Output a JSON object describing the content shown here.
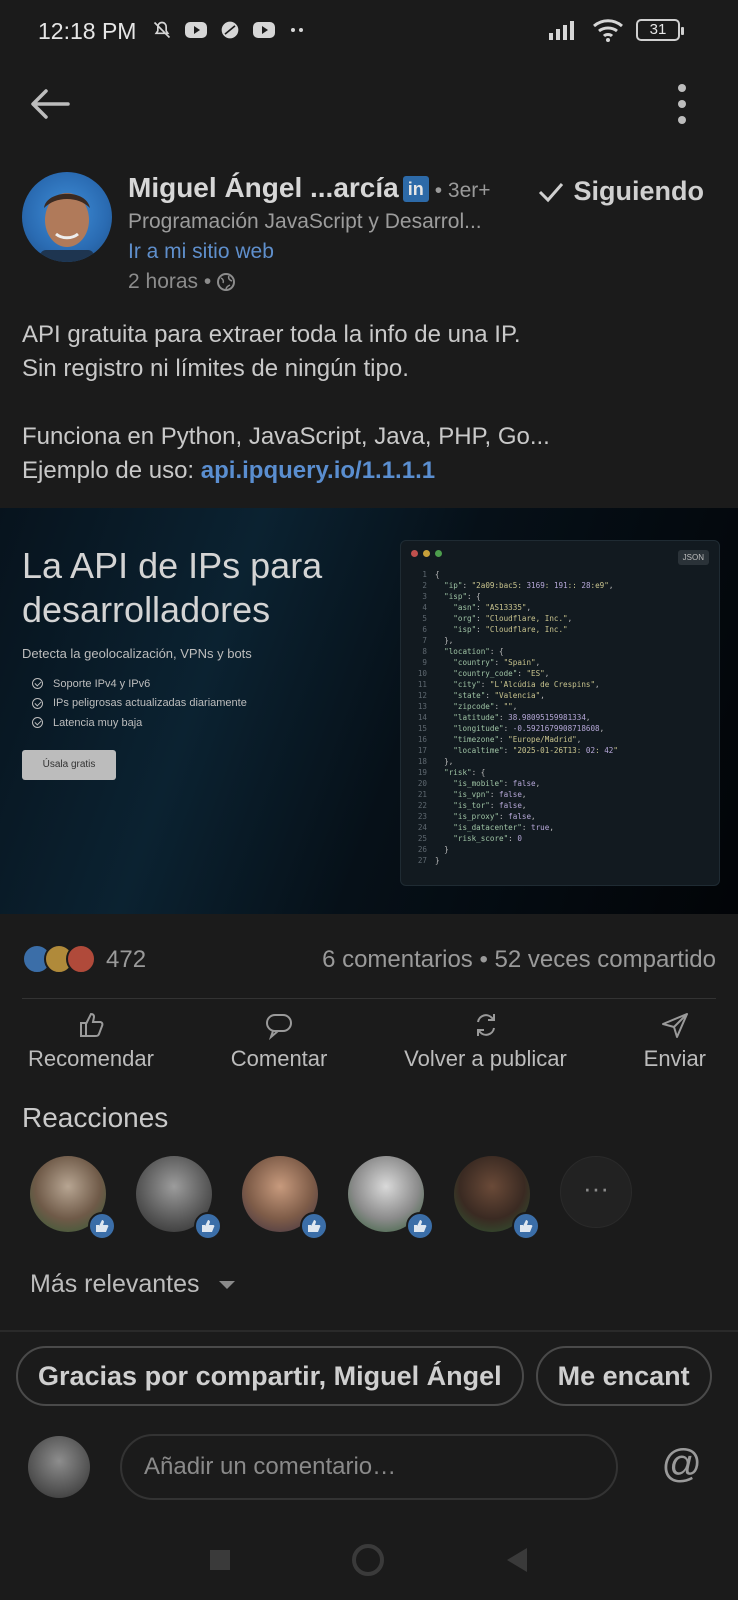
{
  "status_bar": {
    "time": "12:18 PM",
    "battery": "31"
  },
  "author": {
    "name": "Miguel Ángel ...arcía",
    "degree": "• 3er+",
    "headline": "Programación JavaScript y Desarrol...",
    "website": "Ir a mi sitio web",
    "time": "2 horas •",
    "follow_label": "Siguiendo"
  },
  "post": {
    "line1": "API gratuita para extraer toda la info de una IP.",
    "line2": "Sin registro ni límites de ningún tipo.",
    "line3": "Funciona en Python, JavaScript, Java, PHP, Go...",
    "line4_prefix": "Ejemplo de uso: ",
    "line4_link": "api.ipquery.io/1.1.1.1"
  },
  "image": {
    "title": "La API de IPs para desarrolladores",
    "subtitle": "Detecta la geolocalización, VPNs y bots",
    "features": [
      "Soporte IPv4 y IPv6",
      "IPs peligrosas actualizadas diariamente",
      "Latencia muy baja"
    ],
    "button": "Úsala gratis",
    "json_tag": "JSON",
    "code_lines": [
      "{",
      "  \"ip\": \"2a09:bac5:3169:191::28:e9\",",
      "  \"isp\": {",
      "    \"asn\": \"AS13335\",",
      "    \"org\": \"Cloudflare, Inc.\",",
      "    \"isp\": \"Cloudflare, Inc.\"",
      "  },",
      "  \"location\": {",
      "    \"country\": \"Spain\",",
      "    \"country_code\": \"ES\",",
      "    \"city\": \"L'Alcúdia de Crespins\",",
      "    \"state\": \"Valencia\",",
      "    \"zipcode\": \"\",",
      "    \"latitude\": 38.98095159981334,",
      "    \"longitude\": -0.5921679908718608,",
      "    \"timezone\": \"Europe/Madrid\",",
      "    \"localtime\": \"2025-01-26T13:02:42\"",
      "  },",
      "  \"risk\": {",
      "    \"is_mobile\": false,",
      "    \"is_vpn\": false,",
      "    \"is_tor\": false,",
      "    \"is_proxy\": false,",
      "    \"is_datacenter\": true,",
      "    \"risk_score\": 0",
      "  }",
      "}"
    ]
  },
  "stats": {
    "reactions": "472",
    "comments_shares": "6 comentarios • 52 veces compartido"
  },
  "actions": {
    "recommend": "Recomendar",
    "comment": "Comentar",
    "repost": "Volver a publicar",
    "send": "Enviar"
  },
  "reactions_heading": "Reacciones",
  "relevance": "Más relevantes",
  "suggestions": [
    "Gracias por compartir, Miguel Ángel",
    "Me encant"
  ],
  "comment_placeholder": "Añadir un comentario…",
  "colors": {
    "background": "#1b1b1b",
    "link": "#5a8ed0",
    "like": "#3b6ea8"
  }
}
